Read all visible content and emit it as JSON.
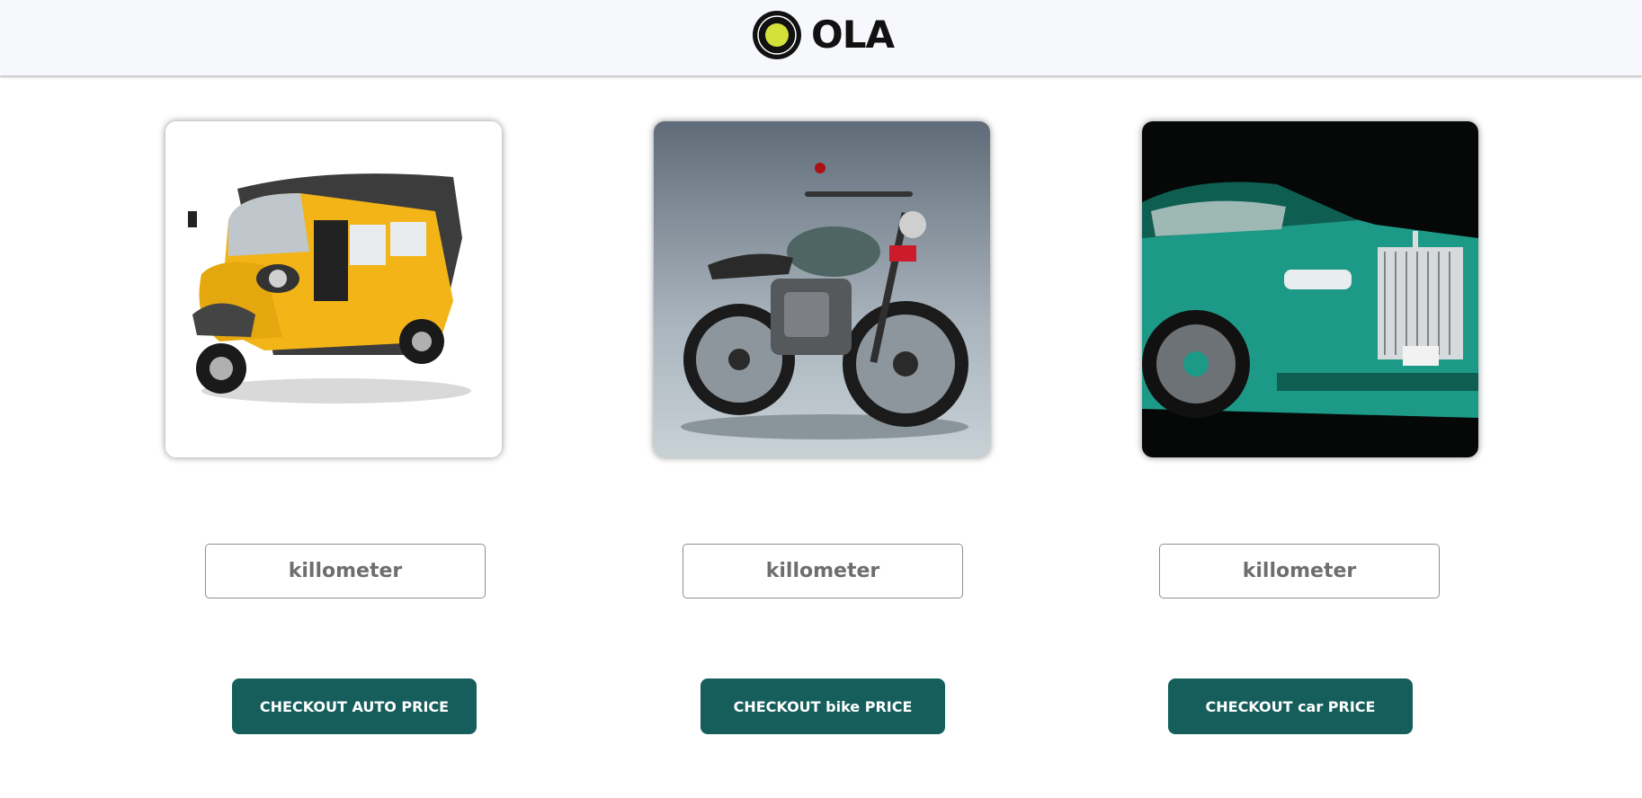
{
  "header": {
    "brand": "OLA",
    "logo_icon": "ola-logo-icon"
  },
  "vehicles": [
    {
      "type": "auto",
      "image_icon": "auto-rickshaw-image",
      "input_placeholder": "killometer",
      "input_value": "",
      "button_label": "CHECKOUT AUTO PRICE"
    },
    {
      "type": "bike",
      "image_icon": "motorcycle-image",
      "input_placeholder": "killometer",
      "input_value": "",
      "button_label": "CHECKOUT bike PRICE"
    },
    {
      "type": "car",
      "image_icon": "luxury-car-image",
      "input_placeholder": "killometer",
      "input_value": "",
      "button_label": "CHECKOUT car PRICE"
    }
  ],
  "colors": {
    "header_bg": "#f7f8fc",
    "button_bg": "#155e5c",
    "logo_yellow": "#d4e13a",
    "auto_yellow": "#f2b417",
    "car_teal": "#1d9a87"
  }
}
